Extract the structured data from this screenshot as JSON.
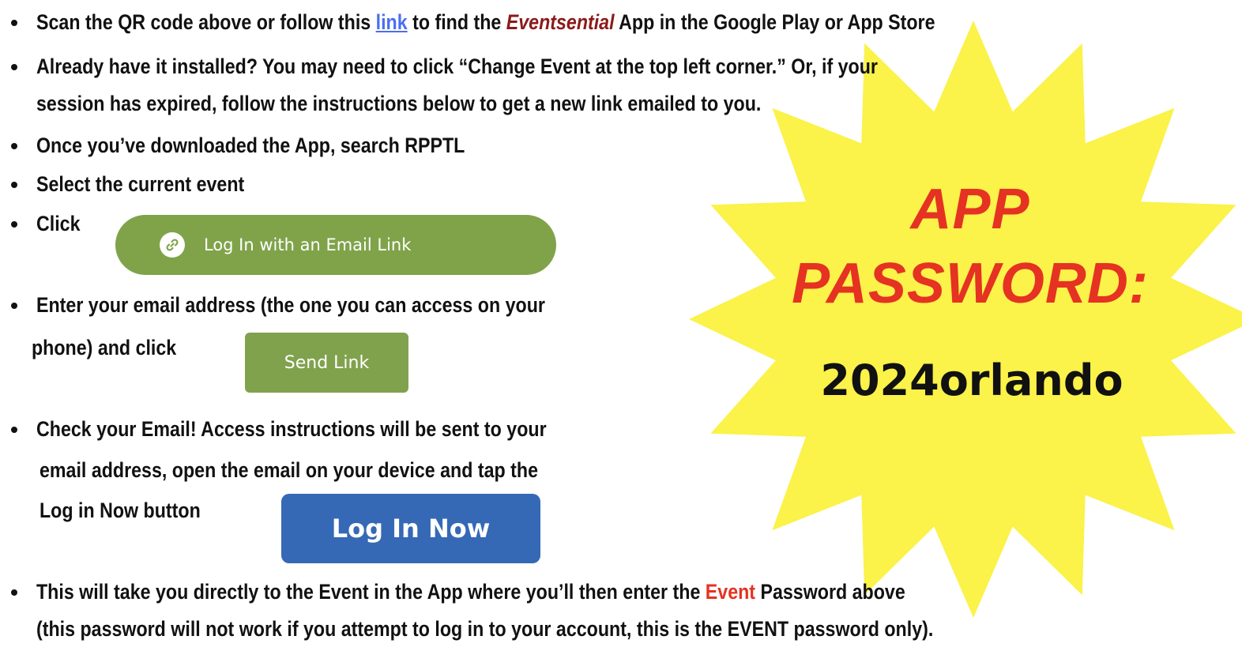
{
  "instructions": {
    "scan": {
      "before": "Scan the QR code above or follow this ",
      "link": "link",
      "middle": " to find the ",
      "brand": "Eventsential",
      "after": " App in the Google Play or App Store"
    },
    "installed": {
      "line1": "Already have it installed?  You may need to click “Change Event at the top left corner.”  Or, if your",
      "line2_before": "session has expired, follow the instructions below to get a new link emailed to you."
    },
    "search": "Once you’ve downloaded the App, search RPPTL",
    "select": "Select the current event",
    "click": "Click",
    "enter": {
      "line1": "Enter your email address (the one you can access on your",
      "line2": "phone) and click"
    },
    "check": {
      "line1": "Check your Email!  Access instructions will be sent to your",
      "line2": "email address, open the email on your device and tap the",
      "line3": "Log in Now button"
    },
    "final": {
      "line1_before": "This will take you directly to the Event in the App where you’ll then enter the ",
      "line1_red": "Event",
      "line1_after": " Password above",
      "line2": "(this password will not work if you attempt to log in to your account, this is the EVENT password only)."
    }
  },
  "buttons": {
    "email_link": "Log In with an Email Link",
    "send_link": "Send Link",
    "log_in_now": "Log In Now"
  },
  "password_badge": {
    "line1": "APP",
    "line2": "PASSWORD:",
    "value": "2024orlando"
  },
  "colors": {
    "star": "#fbf24a",
    "password_heading": "#e53222",
    "brand": "#8b1a1a",
    "link": "#4a6ef0",
    "email_button": "#80a34a",
    "send_button": "#81a24d",
    "login_button": "#3569b5"
  },
  "icons": {
    "email_button_icon": "link-icon"
  }
}
